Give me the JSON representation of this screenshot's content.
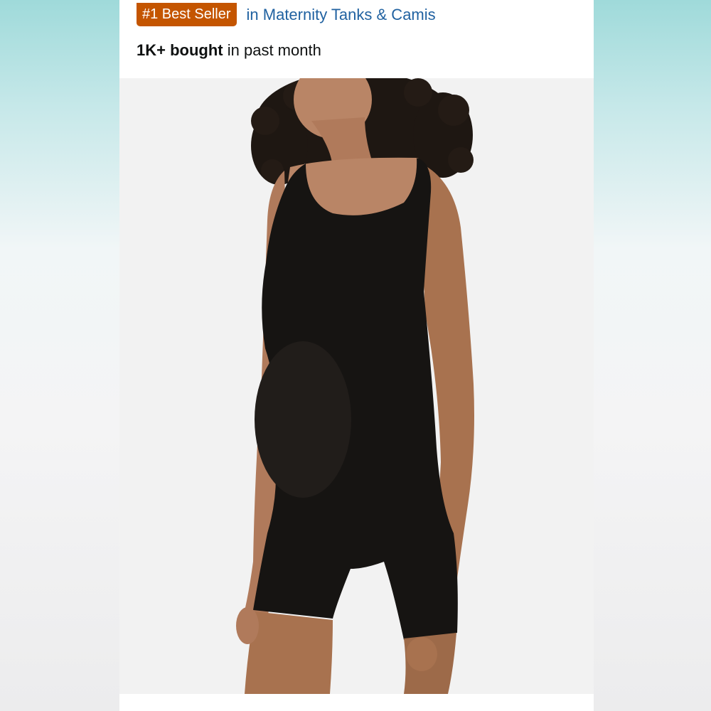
{
  "badge": {
    "label": "#1 Best Seller",
    "color": "#c45500"
  },
  "category": {
    "label": "in Maternity Tanks & Camis",
    "color": "#2162a1"
  },
  "purchase_stat": {
    "count": "1K+ bought",
    "suffix": "in past month"
  },
  "product_image": {
    "description_icon": "product-photo",
    "garment_color": "#161412"
  }
}
